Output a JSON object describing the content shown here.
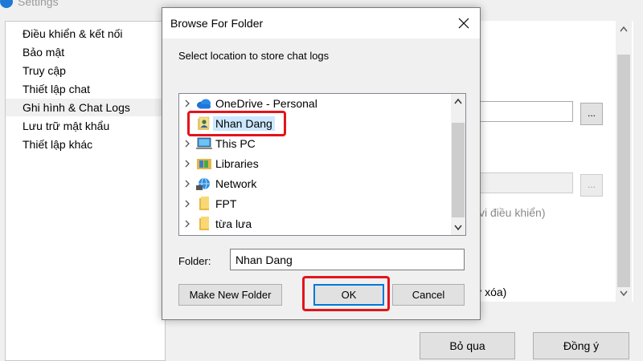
{
  "settings": {
    "title": "Settings",
    "sidebar_items": [
      {
        "label": "Điều khiển & kết nối"
      },
      {
        "label": "Bảo mật"
      },
      {
        "label": "Truy cập"
      },
      {
        "label": "Thiết lập chat"
      },
      {
        "label": "Ghi hình & Chat Logs",
        "active": true
      },
      {
        "label": "Lưu trữ mật khẩu"
      },
      {
        "label": "Thiết lập khác"
      }
    ],
    "browse_button_label": "...",
    "partial_text_1": "vi điều khiển)",
    "partial_text_2": "ờ xóa)",
    "skip_button_label": "Bỏ qua",
    "agree_button_label": "Đồng ý"
  },
  "dialog": {
    "title": "Browse For Folder",
    "instruction": "Select location to store chat logs",
    "tree_items": [
      {
        "label": "OneDrive - Personal",
        "icon": "cloud-icon"
      },
      {
        "label": "Nhan Dang",
        "icon": "user-folder-icon",
        "selected": true
      },
      {
        "label": "This PC",
        "icon": "computer-icon"
      },
      {
        "label": "Libraries",
        "icon": "libraries-icon"
      },
      {
        "label": "Network",
        "icon": "network-icon"
      },
      {
        "label": "FPT",
        "icon": "folder-icon"
      },
      {
        "label": "từa lưa",
        "icon": "folder-icon"
      }
    ],
    "folder_label": "Folder:",
    "folder_value": "Nhan Dang",
    "make_new_folder_label": "Make New Folder",
    "ok_label": "OK",
    "cancel_label": "Cancel"
  },
  "colors": {
    "annotation_red": "#e3141b",
    "selection_blue": "#cce8ff",
    "focus_blue": "#0078d7"
  }
}
